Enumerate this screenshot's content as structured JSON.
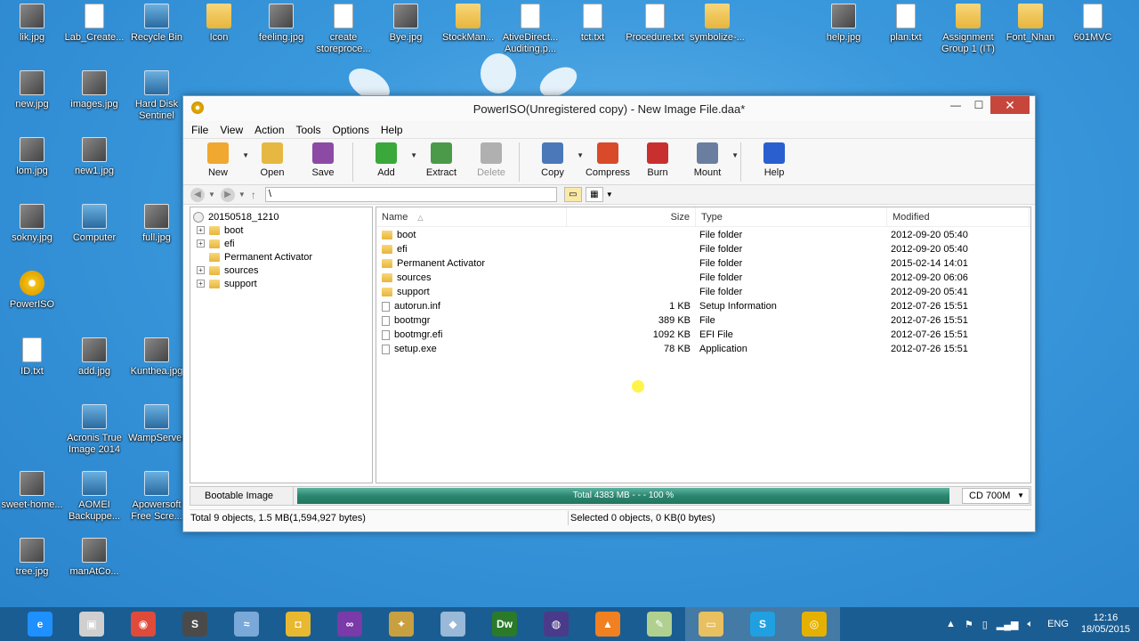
{
  "desktop": {
    "icons": [
      {
        "label": "lik.jpg",
        "kind": "img"
      },
      {
        "label": "Lab_Create...",
        "kind": "file"
      },
      {
        "label": "Recycle Bin",
        "kind": "app"
      },
      {
        "label": "Icon",
        "kind": "folder"
      },
      {
        "label": "feeling.jpg",
        "kind": "img"
      },
      {
        "label": "create storeproce...",
        "kind": "file"
      },
      {
        "label": "Bye.jpg",
        "kind": "img"
      },
      {
        "label": "StockMan...",
        "kind": "folder"
      },
      {
        "label": "AtiveDirect... Auditing.p...",
        "kind": "file"
      },
      {
        "label": "tct.txt",
        "kind": "file"
      },
      {
        "label": "Procedure.txt",
        "kind": "file"
      },
      {
        "label": "symbolize-...",
        "kind": "folder"
      },
      {
        "label": "help.jpg",
        "kind": "img"
      },
      {
        "label": "plan.txt",
        "kind": "file"
      },
      {
        "label": "Assignment Group 1 (IT)",
        "kind": "folder"
      },
      {
        "label": "Font_Nhan",
        "kind": "folder"
      },
      {
        "label": "601MVC",
        "kind": "file"
      },
      {
        "label": "new.jpg",
        "kind": "img"
      },
      {
        "label": "images.jpg",
        "kind": "img"
      },
      {
        "label": "Hard Disk Sentinel",
        "kind": "app"
      },
      {
        "label": "lom.jpg",
        "kind": "img"
      },
      {
        "label": "new1.jpg",
        "kind": "img"
      },
      {
        "label": "sokny.jpg",
        "kind": "img"
      },
      {
        "label": "Computer",
        "kind": "app"
      },
      {
        "label": "full.jpg",
        "kind": "img"
      },
      {
        "label": "PowerISO",
        "kind": "disc"
      },
      {
        "label": "ID.txt",
        "kind": "file"
      },
      {
        "label": "add.jpg",
        "kind": "img"
      },
      {
        "label": "Kunthea.jpg",
        "kind": "img"
      },
      {
        "label": "Acronis True Image 2014",
        "kind": "app"
      },
      {
        "label": "WampServer",
        "kind": "app"
      },
      {
        "label": "sweet-home...",
        "kind": "img"
      },
      {
        "label": "AOMEI Backuppe...",
        "kind": "app"
      },
      {
        "label": "Apowersoft Free Scre...",
        "kind": "app"
      },
      {
        "label": "tree.jpg",
        "kind": "img"
      },
      {
        "label": "manAtCo...",
        "kind": "img"
      }
    ]
  },
  "window": {
    "title": "PowerISO(Unregistered copy) - New Image File.daa*",
    "controls": {
      "minimize": "—",
      "maximize": "☐",
      "close": "✕"
    }
  },
  "menu": [
    "File",
    "View",
    "Action",
    "Tools",
    "Options",
    "Help"
  ],
  "toolbar": {
    "buttons": [
      {
        "label": "New",
        "icon": "new-icon",
        "color": "#f0a830"
      },
      {
        "label": "Open",
        "icon": "open-icon",
        "color": "#e6b842"
      },
      {
        "label": "Save",
        "icon": "save-icon",
        "color": "#8c4aa5"
      },
      {
        "label": "Add",
        "icon": "add-icon",
        "color": "#3aa83a"
      },
      {
        "label": "Extract",
        "icon": "extract-icon",
        "color": "#4a9a4a"
      },
      {
        "label": "Delete",
        "icon": "delete-icon",
        "color": "#b0b0b0"
      },
      {
        "label": "Copy",
        "icon": "copy-icon",
        "color": "#4a78b8"
      },
      {
        "label": "Compress",
        "icon": "compress-icon",
        "color": "#d84a2a"
      },
      {
        "label": "Burn",
        "icon": "burn-icon",
        "color": "#c83030"
      },
      {
        "label": "Mount",
        "icon": "mount-icon",
        "color": "#6a7fa0"
      },
      {
        "label": "Help",
        "icon": "help-icon",
        "color": "#2a5fd0"
      }
    ]
  },
  "address": {
    "path": "\\"
  },
  "tree": {
    "root": "20150518_1210",
    "items": [
      {
        "label": "boot",
        "expandable": true
      },
      {
        "label": "efi",
        "expandable": true
      },
      {
        "label": "Permanent Activator",
        "expandable": false
      },
      {
        "label": "sources",
        "expandable": true
      },
      {
        "label": "support",
        "expandable": true
      }
    ]
  },
  "list": {
    "columns": {
      "name": "Name",
      "size": "Size",
      "type": "Type",
      "modified": "Modified"
    },
    "rows": [
      {
        "name": "boot",
        "size": "",
        "type": "File folder",
        "modified": "2012-09-20 05:40",
        "kind": "folder"
      },
      {
        "name": "efi",
        "size": "",
        "type": "File folder",
        "modified": "2012-09-20 05:40",
        "kind": "folder"
      },
      {
        "name": "Permanent Activator",
        "size": "",
        "type": "File folder",
        "modified": "2015-02-14 14:01",
        "kind": "folder"
      },
      {
        "name": "sources",
        "size": "",
        "type": "File folder",
        "modified": "2012-09-20 06:06",
        "kind": "folder"
      },
      {
        "name": "support",
        "size": "",
        "type": "File folder",
        "modified": "2012-09-20 05:41",
        "kind": "folder"
      },
      {
        "name": "autorun.inf",
        "size": "1 KB",
        "type": "Setup Information",
        "modified": "2012-07-26 15:51",
        "kind": "file"
      },
      {
        "name": "bootmgr",
        "size": "389 KB",
        "type": "File",
        "modified": "2012-07-26 15:51",
        "kind": "file"
      },
      {
        "name": "bootmgr.efi",
        "size": "1092 KB",
        "type": "EFI File",
        "modified": "2012-07-26 15:51",
        "kind": "file"
      },
      {
        "name": "setup.exe",
        "size": "78 KB",
        "type": "Application",
        "modified": "2012-07-26 15:51",
        "kind": "file"
      }
    ]
  },
  "status": {
    "bootable": "Bootable Image",
    "progress_text": "Total  4383 MB   - - -  100 %",
    "progress_fraction": 1.0,
    "media": "CD 700M",
    "total": "Total 9 objects, 1.5 MB(1,594,927 bytes)",
    "selected": "Selected 0 objects, 0 KB(0 bytes)"
  },
  "taskbar": {
    "apps": [
      {
        "icon": "ie-icon",
        "color": "#1e90ff",
        "glyph": "e"
      },
      {
        "icon": "installer-icon",
        "color": "#cfcfcf",
        "glyph": "▣"
      },
      {
        "icon": "chrome-icon",
        "color": "#e04a3a",
        "glyph": "◉"
      },
      {
        "icon": "sublime-icon",
        "color": "#4a4a4a",
        "glyph": "S"
      },
      {
        "icon": "dolphin-icon",
        "color": "#7aa8d8",
        "glyph": "≈"
      },
      {
        "icon": "photo-icon",
        "color": "#e8b830",
        "glyph": "◘"
      },
      {
        "icon": "visual-studio-icon",
        "color": "#7a3aa8",
        "glyph": "∞"
      },
      {
        "icon": "tools-icon",
        "color": "#c8a040",
        "glyph": "✦"
      },
      {
        "icon": "box-icon",
        "color": "#9ab8d8",
        "glyph": "◆"
      },
      {
        "icon": "dreamweaver-icon",
        "color": "#2a7a2a",
        "glyph": "Dw"
      },
      {
        "icon": "eclipse-icon",
        "color": "#4a3a8a",
        "glyph": "◍"
      },
      {
        "icon": "vlc-icon",
        "color": "#f08020",
        "glyph": "▲"
      },
      {
        "icon": "notepad-icon",
        "color": "#b0d090",
        "glyph": "✎"
      },
      {
        "icon": "explorer-icon",
        "color": "#e8c060",
        "glyph": "▭"
      },
      {
        "icon": "skype-icon",
        "color": "#20a0e0",
        "glyph": "S"
      },
      {
        "icon": "poweriso-icon",
        "color": "#e5b100",
        "glyph": "◎"
      }
    ],
    "tray": {
      "lang": "ENG",
      "time": "12:16",
      "date": "18/05/2015"
    }
  }
}
